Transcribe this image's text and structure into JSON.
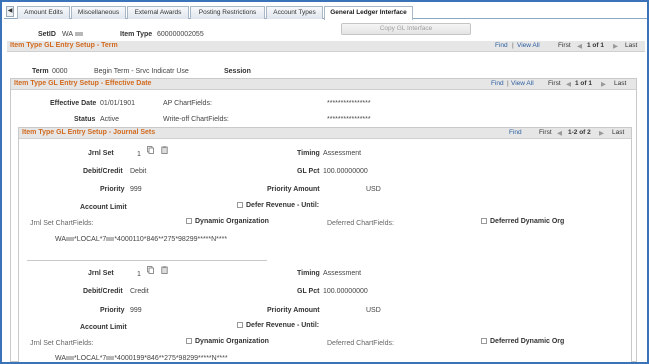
{
  "tabs": {
    "items": [
      "Amount Edits",
      "Miscellaneous",
      "External Awards",
      "Posting Restrictions",
      "Account Types",
      "General Ledger Interface"
    ],
    "active": "General Ledger Interface"
  },
  "header": {
    "setid_label": "SetID",
    "setid_value": "WA",
    "item_type_label": "Item Type",
    "item_type_value": "600000002055",
    "copy_button": "Copy GL Interface"
  },
  "term_group": {
    "title": "Item Type GL Entry Setup - Term",
    "find": "Find",
    "view_all": "View All",
    "first": "First",
    "pager": "1 of 1",
    "last": "Last",
    "term_label": "Term",
    "term_value": "0000",
    "term_desc": "Begin Term - Srvc Indicatr Use",
    "session_label": "Session"
  },
  "effdt_group": {
    "title": "Item Type GL Entry Setup - Effective Date",
    "find": "Find",
    "view_all": "View All",
    "first": "First",
    "pager": "1 of 1",
    "last": "Last",
    "eff_date_label": "Effective Date",
    "eff_date_value": "01/01/1901",
    "ap_label": "AP ChartFields:",
    "ap_value": "****************",
    "status_label": "Status",
    "status_value": "Active",
    "writeoff_label": "Write-off ChartFields:",
    "writeoff_value": "****************"
  },
  "journal_group": {
    "title": "Item Type GL Entry Setup - Journal Sets",
    "find": "Find",
    "first": "First",
    "pager": "1-2 of 2",
    "last": "Last"
  },
  "journal_sets": [
    {
      "jrnl_set_label": "Jrnl Set",
      "jrnl_set_value": "1",
      "timing_label": "Timing",
      "timing_value": "Assessment",
      "debit_credit_label": "Debit/Credit",
      "debit_credit_value": "Debit",
      "gl_pct_label": "GL Pct",
      "gl_pct_value": "100.00000000",
      "priority_label": "Priority",
      "priority_value": "999",
      "priority_amount_label": "Priority Amount",
      "currency": "USD",
      "account_limit_label": "Account Limit",
      "defer_label": "Defer Revenue - Until:",
      "jrnl_cf_label": "Jrnl Set ChartFields:",
      "dyn_org_label": "Dynamic Organization",
      "deferred_cf_label": "Deferred ChartFields:",
      "deferred_dyn_label": "Deferred Dynamic Org",
      "chartfield_prefix": "WA",
      "chartfield_mid": "*LOCAL*7",
      "chartfield_suffix": "*4000110*846**275*98299*****N****"
    },
    {
      "jrnl_set_label": "Jrnl Set",
      "jrnl_set_value": "1",
      "timing_label": "Timing",
      "timing_value": "Assessment",
      "debit_credit_label": "Debit/Credit",
      "debit_credit_value": "Credit",
      "gl_pct_label": "GL Pct",
      "gl_pct_value": "100.00000000",
      "priority_label": "Priority",
      "priority_value": "999",
      "priority_amount_label": "Priority Amount",
      "currency": "USD",
      "account_limit_label": "Account Limit",
      "defer_label": "Defer Revenue - Until:",
      "jrnl_cf_label": "Jrnl Set ChartFields:",
      "dyn_org_label": "Dynamic Organization",
      "deferred_cf_label": "Deferred ChartFields:",
      "deferred_dyn_label": "Deferred Dynamic Org",
      "chartfield_prefix": "WA",
      "chartfield_mid": "*LOCAL*7",
      "chartfield_suffix": "*4000199*846**275*98299*****N****"
    }
  ],
  "colors": {
    "accent": "#3b73b9",
    "group_title": "#d26a1e",
    "link": "#2a5d9f"
  }
}
